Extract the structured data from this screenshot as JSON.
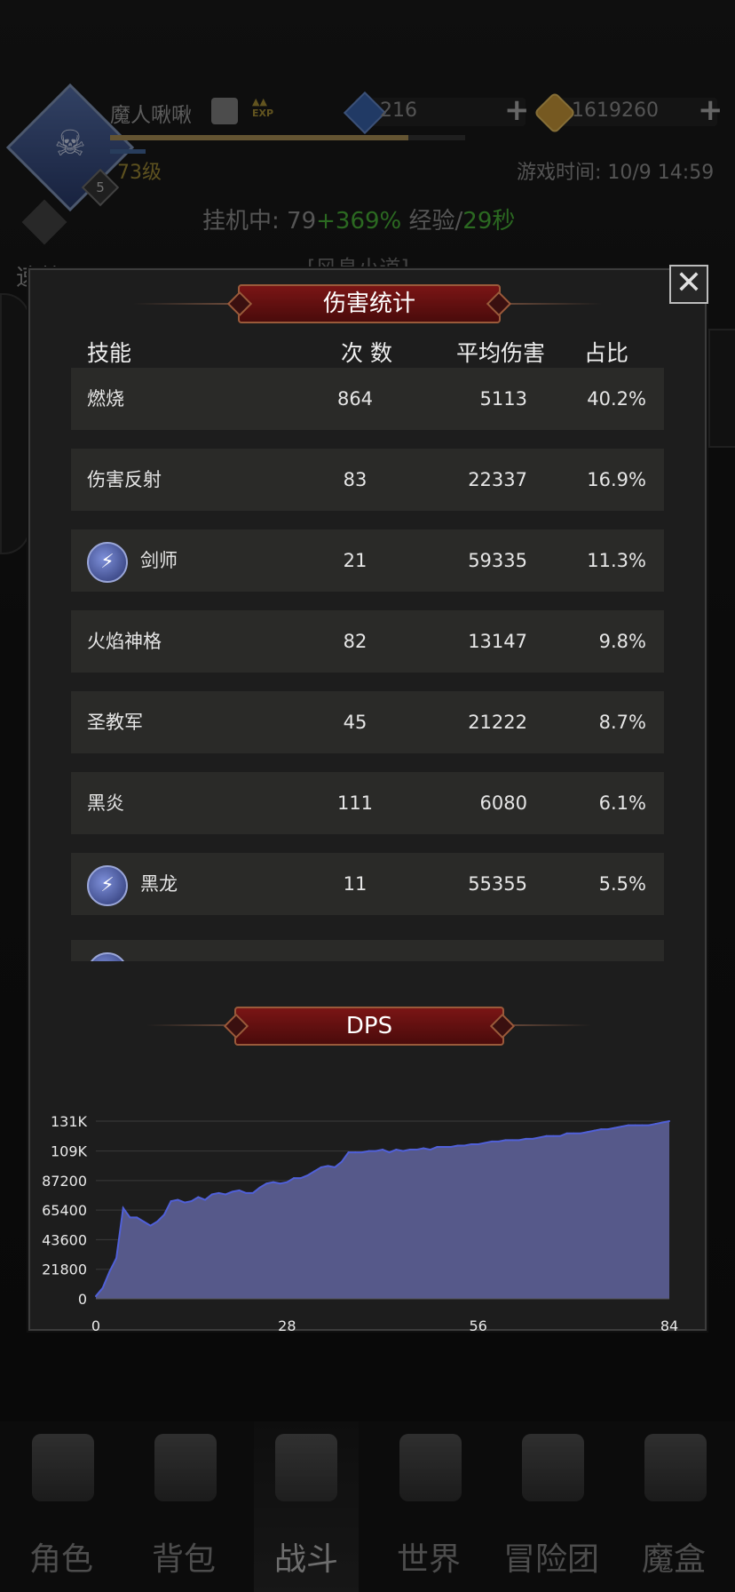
{
  "header": {
    "player_name": "魔人啾啾",
    "exp_icon": "EXP",
    "level": "73级",
    "avatar_badge": "5",
    "gems": "216",
    "gold": "1619260",
    "game_time": "游戏时间: 10/9 14:59",
    "idle_label": "挂机中: ",
    "idle_value": "79",
    "idle_bonus": "+369%",
    "exp_label": " 经验/",
    "exp_time": "29秒",
    "quick_battle": "速战",
    "location": "[风息小道]"
  },
  "modal": {
    "title": "伤害统计",
    "close_icon": "close-icon",
    "columns": [
      "技能",
      "次 数",
      "平均伤害",
      "占比"
    ],
    "rows": [
      {
        "name": "燃烧",
        "count": "864",
        "avg": "5113",
        "pct": "40.2%",
        "icon": false
      },
      {
        "name": "伤害反射",
        "count": "83",
        "avg": "22337",
        "pct": "16.9%",
        "icon": false
      },
      {
        "name": "剑师",
        "count": "21",
        "avg": "59335",
        "pct": "11.3%",
        "icon": true
      },
      {
        "name": "火焰神格",
        "count": "82",
        "avg": "13147",
        "pct": "9.8%",
        "icon": false
      },
      {
        "name": "圣教军",
        "count": "45",
        "avg": "21222",
        "pct": "8.7%",
        "icon": false
      },
      {
        "name": "黑炎",
        "count": "111",
        "avg": "6080",
        "pct": "6.1%",
        "icon": false
      },
      {
        "name": "黑龙",
        "count": "11",
        "avg": "55355",
        "pct": "5.5%",
        "icon": true
      }
    ],
    "dps_title": "DPS"
  },
  "chart_data": {
    "type": "area",
    "title": "DPS",
    "xlabel": "",
    "ylabel": "",
    "x_ticks": [
      0,
      28,
      56,
      84
    ],
    "y_ticks": [
      "0",
      "21800",
      "43600",
      "65400",
      "87200",
      "109K",
      "131K"
    ],
    "y_tick_values": [
      0,
      21800,
      43600,
      65400,
      87200,
      109000,
      131000
    ],
    "xlim": [
      0,
      84
    ],
    "ylim": [
      0,
      131000
    ],
    "grid": true,
    "color": "#56598a",
    "line_color": "#5060d8",
    "x": [
      0,
      1,
      2,
      3,
      4,
      5,
      6,
      7,
      8,
      9,
      10,
      11,
      12,
      13,
      14,
      15,
      16,
      17,
      18,
      19,
      20,
      21,
      22,
      23,
      24,
      25,
      26,
      27,
      28,
      29,
      30,
      31,
      32,
      33,
      34,
      35,
      36,
      37,
      38,
      39,
      40,
      41,
      42,
      43,
      44,
      45,
      46,
      47,
      48,
      49,
      50,
      51,
      52,
      53,
      54,
      55,
      56,
      57,
      58,
      59,
      60,
      61,
      62,
      63,
      64,
      65,
      66,
      67,
      68,
      69,
      70,
      71,
      72,
      73,
      74,
      75,
      76,
      77,
      78,
      79,
      80,
      81,
      82,
      83,
      84
    ],
    "values": [
      2000,
      8000,
      20000,
      30000,
      67000,
      60000,
      60000,
      57000,
      54000,
      57000,
      62000,
      72000,
      73000,
      71000,
      72000,
      75000,
      73000,
      77000,
      78000,
      77000,
      79000,
      80000,
      78000,
      78000,
      82000,
      85000,
      86000,
      85000,
      86000,
      89000,
      89000,
      91000,
      94000,
      97000,
      98000,
      97000,
      101000,
      108000,
      108000,
      108000,
      109000,
      109000,
      110000,
      108000,
      110000,
      109000,
      110000,
      110000,
      111000,
      110000,
      112000,
      112000,
      112000,
      113000,
      113000,
      114000,
      114000,
      115000,
      116000,
      116000,
      117000,
      117000,
      117000,
      118000,
      118000,
      119000,
      120000,
      120000,
      120000,
      122000,
      122000,
      122000,
      123000,
      124000,
      125000,
      125000,
      126000,
      127000,
      128000,
      128000,
      128000,
      128000,
      129000,
      130000,
      131000
    ]
  },
  "bottom_nav": [
    {
      "label": "角色",
      "icon": "helmet-icon"
    },
    {
      "label": "背包",
      "icon": "backpack-icon"
    },
    {
      "label": "战斗",
      "icon": "shield-swords-icon"
    },
    {
      "label": "世界",
      "icon": "map-icon"
    },
    {
      "label": "冒险团",
      "icon": "castle-icon"
    },
    {
      "label": "魔盒",
      "icon": "magic-cube-icon"
    }
  ]
}
